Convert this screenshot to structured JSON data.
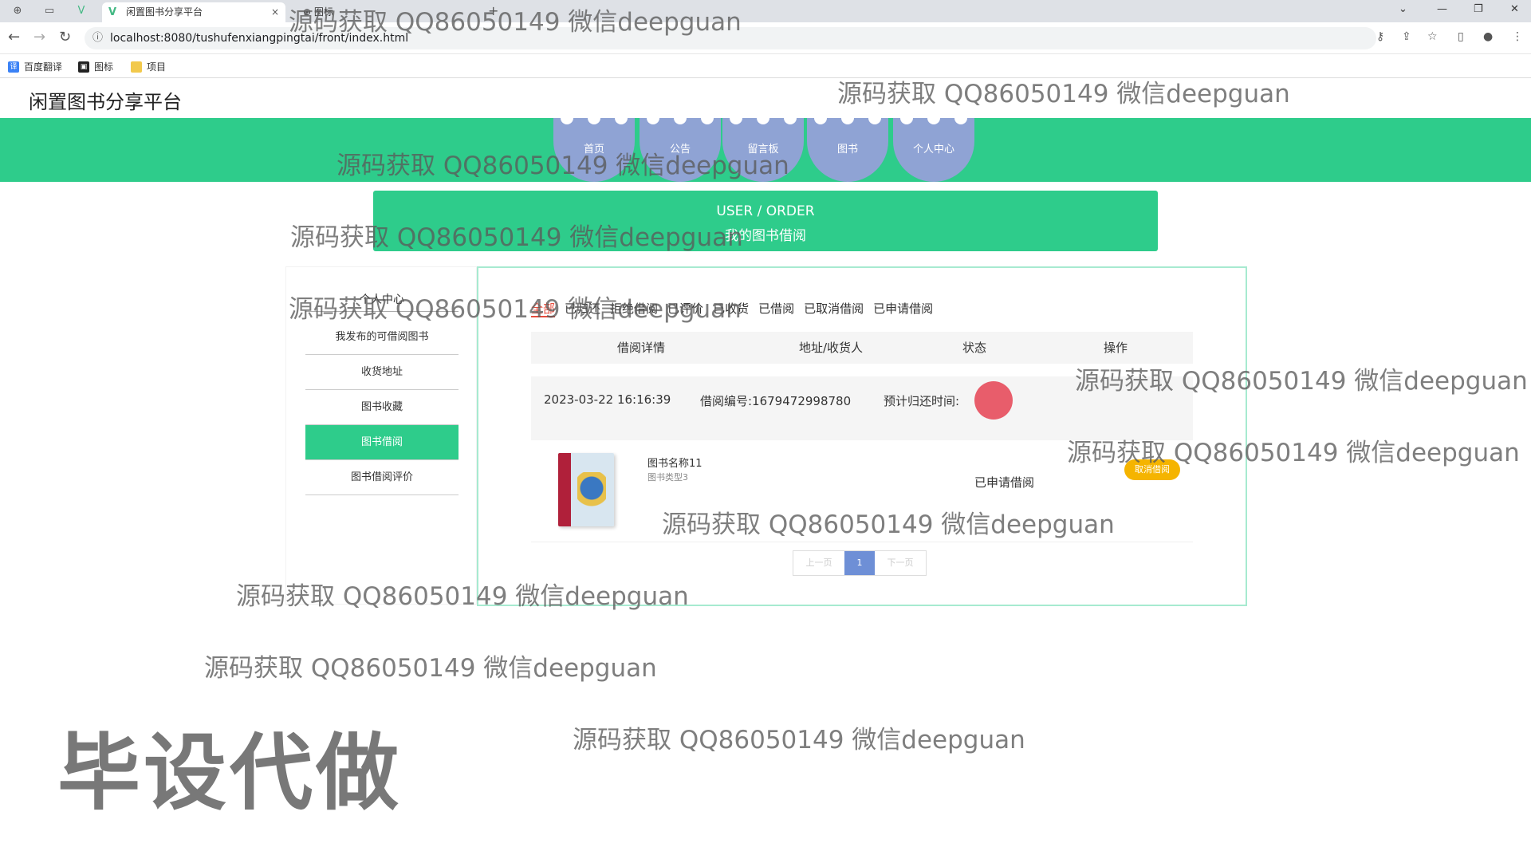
{
  "browser": {
    "tabs": [
      "闲置图书分享平台",
      "图标"
    ],
    "url": "localhost:8080/tushufenxiangpingtai/front/index.html",
    "bookmarks": [
      "百度翻译",
      "图标",
      "项目"
    ]
  },
  "site": {
    "title": "闲置图书分享平台"
  },
  "nav": {
    "items": [
      "首页",
      "公告",
      "留言板",
      "图书",
      "个人中心"
    ]
  },
  "banner": {
    "en": "USER / ORDER",
    "cn": "我的图书借阅"
  },
  "sidebar": {
    "header": "个人中心",
    "items": [
      "我发布的可借阅图书",
      "收货地址",
      "图书收藏",
      "图书借阅",
      "图书借阅评价"
    ],
    "active": "图书借阅"
  },
  "order_tabs": [
    "全部",
    "已归还",
    "拒绝借阅",
    "已评价",
    "已收货",
    "已借阅",
    "已取消借阅",
    "已申请借阅"
  ],
  "active_tab": "全部",
  "table": {
    "headers": [
      "借阅详情",
      "地址/收货人",
      "状态",
      "操作"
    ]
  },
  "order": {
    "date": "2023-03-22 16:16:39",
    "number": "借阅编号:1679472998780",
    "return_time": "预计归还时间:",
    "book_name": "图书名称11",
    "book_type": "图书类型3",
    "status": "已申请借阅",
    "action": "取消借阅"
  },
  "pagination": {
    "prev": "上一页",
    "current": "1",
    "next": "下一页"
  },
  "watermark": {
    "text": "源码获取 QQ86050149 微信deepguan",
    "big": "毕设代做"
  },
  "colors": {
    "accent": "#2ecc8b",
    "nav_item": "#8fa3d4",
    "warning": "#f5b400",
    "active_tab": "#e74c3c"
  }
}
